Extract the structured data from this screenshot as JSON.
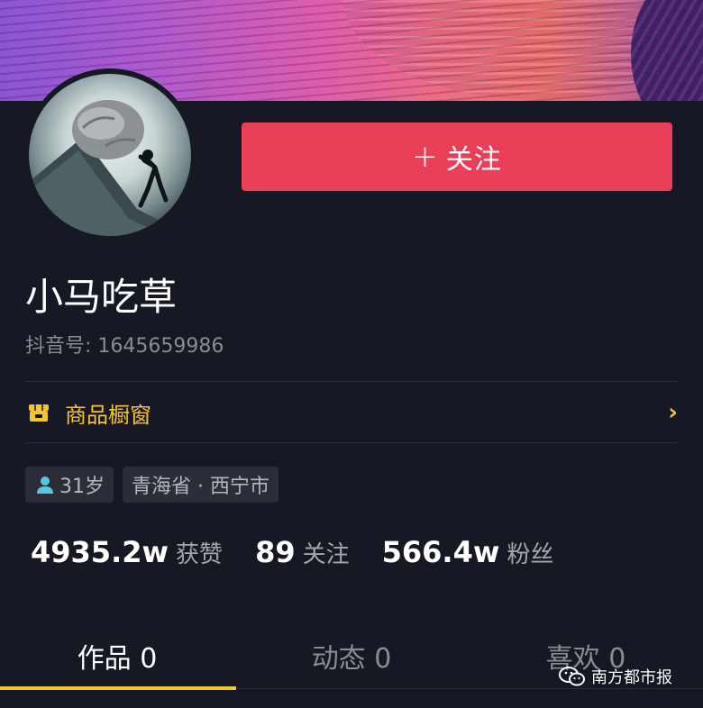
{
  "profile": {
    "username": "小马吃草",
    "douyin_id": "抖音号: 1645659986"
  },
  "actions": {
    "follow_plus": "+",
    "follow_label": "关注"
  },
  "shop": {
    "label": "商品橱窗",
    "chevron": "›"
  },
  "tags": {
    "age": "31岁",
    "location": "青海省 · 西宁市"
  },
  "stats": [
    {
      "value": "4935.2w",
      "label": "获赞"
    },
    {
      "value": "89",
      "label": "关注"
    },
    {
      "value": "566.4w",
      "label": "粉丝"
    }
  ],
  "tabs": [
    {
      "label": "作品 0",
      "active": true
    },
    {
      "label": "动态 0",
      "active": false
    },
    {
      "label": "喜欢 0",
      "active": false
    }
  ],
  "watermark": {
    "text": "南方都市报"
  },
  "colors": {
    "background": "#161823",
    "follow_button": "#ea3f59",
    "accent_yellow": "#f5c430",
    "tag_background": "#2b2d39"
  },
  "icons": {
    "shop": "storefront-icon",
    "chevron": "chevron-right-icon",
    "user": "user-icon",
    "wechat": "wechat-icon"
  }
}
